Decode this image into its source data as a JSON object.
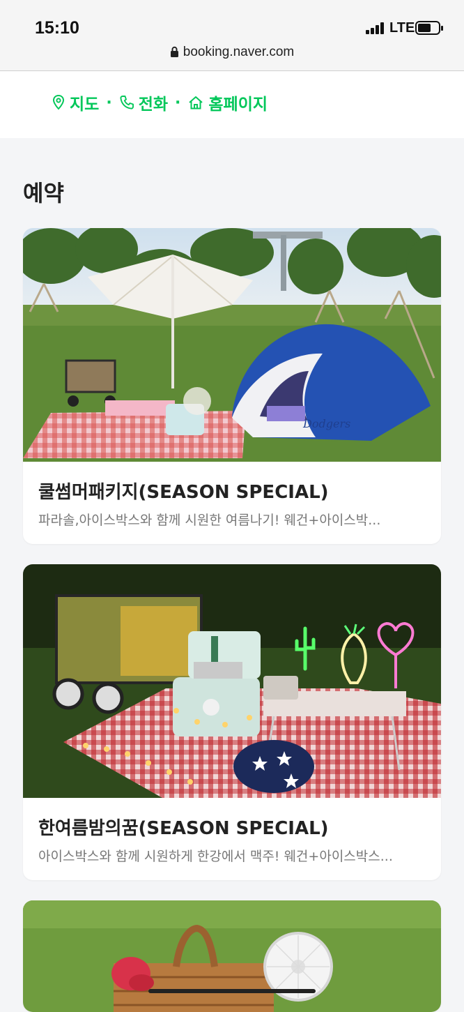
{
  "status_bar": {
    "time": "15:10",
    "network": "LTE",
    "url": "booking.naver.com"
  },
  "info": {
    "links": [
      {
        "label": "지도",
        "icon": "map-pin-icon"
      },
      {
        "label": "전화",
        "icon": "phone-icon"
      },
      {
        "label": "홈페이지",
        "icon": "home-icon"
      }
    ],
    "separator": "·",
    "accent_color": "#03c75a"
  },
  "section": {
    "title": "예약"
  },
  "cards": [
    {
      "title": "쿨썸머패키지(SEASON SPECIAL)",
      "description": "파라솔,아이스박스와 함께 시원한 여름나기! 웨건+아이스박..."
    },
    {
      "title": "한여름밤의꿈(SEASON SPECIAL)",
      "description": "아이스박스와 함께 시원하게 한강에서 맥주! 웨건+아이스박스..."
    }
  ]
}
